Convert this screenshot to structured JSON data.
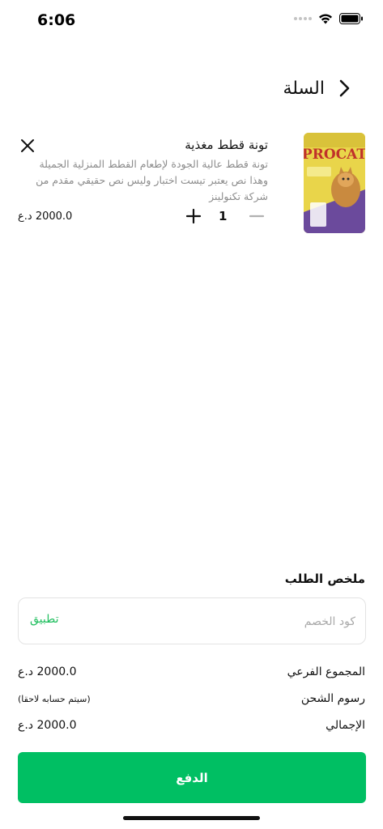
{
  "status_bar": {
    "time": "6:06"
  },
  "header": {
    "title": "السلة"
  },
  "cart_item": {
    "brand_text": "PROCAT",
    "name": "تونة قطط مغذية",
    "description": "تونة قطط عالية الجودة لإطعام القطط المنزلية الجميلة وهذا نص يعتبر تيست اختبار وليس نص حقيقي مقدم من شركة تكنولينز",
    "quantity": "1",
    "price": "2000.0 د.ع"
  },
  "summary": {
    "title": "ملخص الطلب",
    "coupon_placeholder": "كود الخصم",
    "apply_label": "تطبيق",
    "subtotal_label": "المجموع الفرعي",
    "subtotal_value": "2000.0 د.ع",
    "shipping_label": "رسوم الشحن",
    "shipping_value": "(سيتم حسابه لاحقا)",
    "total_label": "الإجمالي",
    "total_value": "2000.0 د.ع"
  },
  "pay_button": {
    "label": "الدفع"
  },
  "colors": {
    "accent": "#00bf63",
    "apply_text": "#1ebe5d",
    "muted_text": "#8c8c8c"
  }
}
